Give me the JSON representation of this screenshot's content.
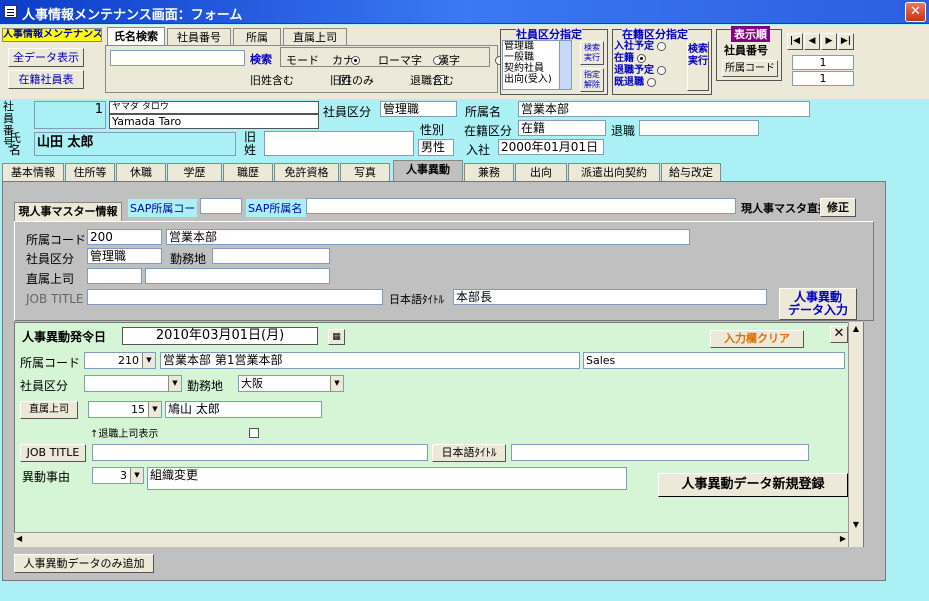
{
  "window": {
    "title": "人事情報メンテナンス画面：フォーム",
    "close": "✕"
  },
  "top": {
    "menu_label": "人事情報メンテナンス",
    "all_data_btn": "全データ表示",
    "roster_btn": "在籍社員表",
    "tabs": [
      "氏名検索",
      "社員番号",
      "所属",
      "直属上司"
    ],
    "search_btn": "検索",
    "mode_label": "モード",
    "mode_kana": "カナ",
    "mode_roma": "ローマ字",
    "mode_kanji": "漢字",
    "old_name_include": "旧姓含む",
    "old_name_only": "旧姓のみ",
    "retired_include": "退職含む"
  },
  "class_filter": {
    "title": "社員区分指定",
    "items": [
      "管理職",
      "一般職",
      "契約社員",
      "出向(受入)"
    ],
    "exec": "検索実行",
    "clear": "指定解除"
  },
  "status_filter": {
    "title": "在籍区分指定",
    "items": [
      "入社予定",
      "在籍",
      "退職予定",
      "既退職"
    ],
    "exec": "検索実行"
  },
  "display_order": {
    "title": "表示順",
    "emp_no": "社員番号",
    "dept_code": "所属コード"
  },
  "nav": {
    "first": "|◀",
    "prev": "◀",
    "next": "▶",
    "last": "▶|",
    "page1": "1",
    "page2": "1"
  },
  "employee": {
    "no_label": "社員番号",
    "no": "1",
    "kana": "ヤマダ タロウ",
    "roman": "Yamada Taro",
    "class_label": "社員区分",
    "class": "管理職",
    "dept_label": "所属名",
    "dept": "営業本部",
    "name_label": "氏名",
    "name": "山田 太郎",
    "old_label": "旧姓",
    "gender_label": "性別",
    "gender": "男性",
    "status_label": "在籍区分",
    "status": "在籍",
    "retire_label": "退職",
    "join_label": "入社",
    "join": "2000年01月01日"
  },
  "tabs": [
    "基本情報",
    "住所等",
    "休職",
    "学歴",
    "職歴",
    "免許資格",
    "写真",
    "人事異動",
    "兼務",
    "出向",
    "派遣出向契約",
    "給与改定"
  ],
  "current": {
    "master_tab": "現人事マスター情報",
    "sap_code_label": "SAP所属コー",
    "sap_name_label": "SAP所属名",
    "direct_edit": "現人事マスタ直接修",
    "fix_btn": "修正",
    "dept_code_label": "所属コード",
    "dept_code": "200",
    "dept_name": "営業本部",
    "class_label": "社員区分",
    "class": "管理職",
    "location_label": "勤務地",
    "boss_label": "直属上司",
    "job_title_label": "JOB TITLE",
    "jp_title_label": "日本語ﾀｲﾄﾙ",
    "jp_title": "本部長",
    "entry_btn1": "人事異動",
    "entry_btn2": "データ入力"
  },
  "transfer": {
    "date_label": "人事異動発令日",
    "date": "2010年03月01日(月)",
    "clear_btn": "入力欄クリア",
    "dept_code_label": "所属コード",
    "dept_code": "210",
    "dept_name": "営業本部 第1営業本部",
    "dept_en": "Sales",
    "class_label": "社員区分",
    "location_label": "勤務地",
    "location": "大阪",
    "boss_btn": "直属上司",
    "boss_code": "15",
    "boss_name": "鳩山 太郎",
    "retired_boss": "↑退職上司表示",
    "job_title_btn": "JOB TITLE",
    "jp_title_btn": "日本語ﾀｲﾄﾙ",
    "reason_label": "異動事由",
    "reason_code": "3",
    "reason": "組織変更",
    "register_btn": "人事異動データ新規登録"
  },
  "bottom": {
    "add_only_btn": "人事異動データのみ追加"
  },
  "colors": {
    "title_blue": "#0c3cc8",
    "cyan": "#aaf0f4",
    "green": "#d6f5d6",
    "gray": "#c0c0c0",
    "blue_text": "#0000c0"
  }
}
